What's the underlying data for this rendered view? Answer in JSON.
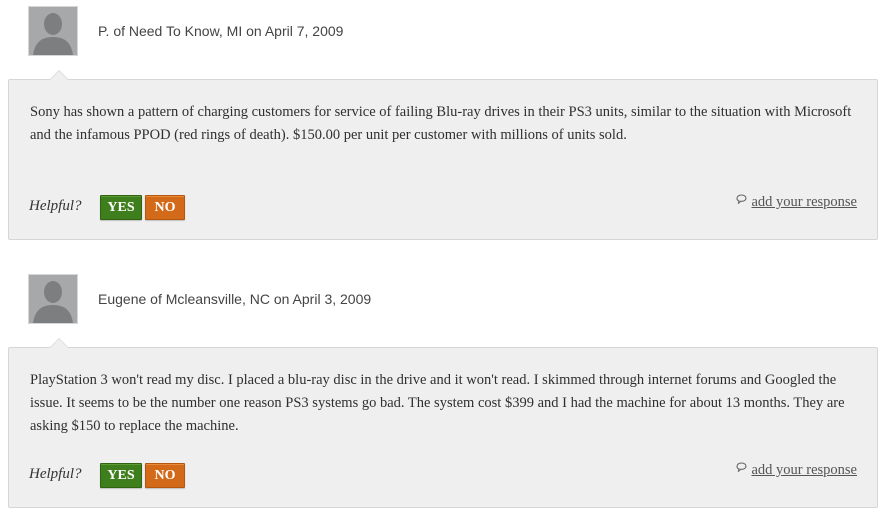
{
  "reviews": [
    {
      "author": "P. of Need To Know, MI on April 7, 2009",
      "text": "Sony has shown a pattern of charging customers for service of failing Blu-ray drives in their PS3 units, similar to the situation with Microsoft and the infamous PPOD (red rings of death). $150.00 per unit per customer with millions of units sold.",
      "helpful_label": "Helpful?",
      "yes_label": "YES",
      "no_label": "NO",
      "respond_label": "add your response"
    },
    {
      "author": "Eugene of Mcleansville, NC on April 3, 2009",
      "text": "PlayStation 3 won't read my disc. I placed a blu-ray disc in the drive and it won't read. I skimmed through internet forums and Googled the issue. It seems to be the number one reason PS3 systems go bad. The system cost $399 and I had the machine for about 13 months. They are asking $150 to replace the machine.",
      "helpful_label": "Helpful?",
      "yes_label": "YES",
      "no_label": "NO",
      "respond_label": "add your response"
    }
  ],
  "colors": {
    "yes_button": "#3f7e1c",
    "no_button": "#d36a1a",
    "bubble_bg": "#efefef",
    "avatar_bg": "#a6a8aa"
  },
  "icons": {
    "avatar": "default-avatar-silhouette-icon",
    "respond": "speech-bubble-icon"
  }
}
